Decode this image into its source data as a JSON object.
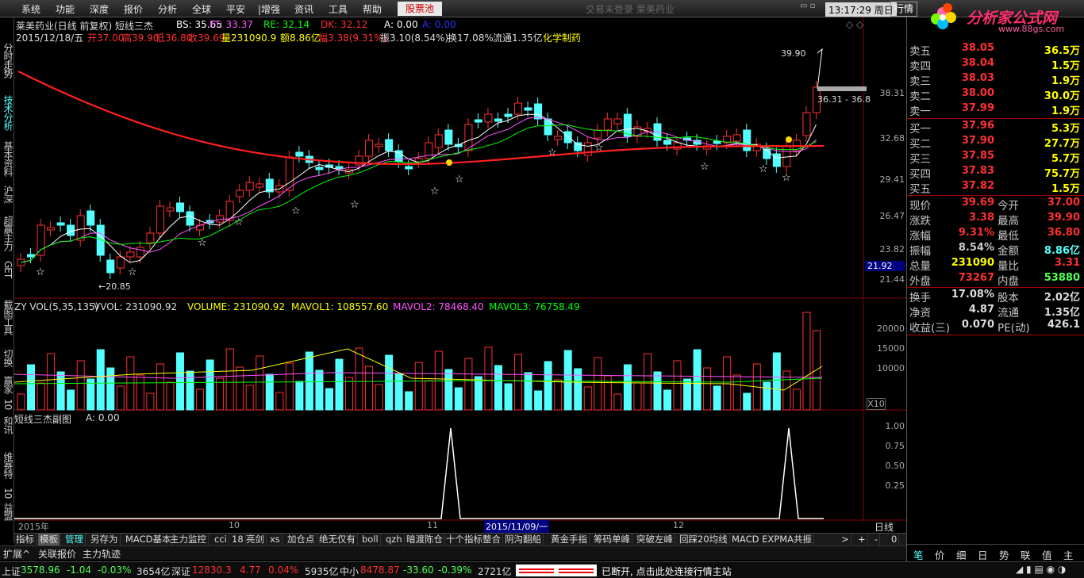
{
  "menu": [
    "系统",
    "功能",
    "深度",
    "报价",
    "分析",
    "全球",
    "平安",
    "|增强",
    "资讯",
    "工具",
    "帮助"
  ],
  "stock_pool": "股票池",
  "trade_status": "交易未登录    莱美药业",
  "datetime": "13:17:29 周日",
  "quote_button": "行情",
  "logo": {
    "text": "分析家公式网",
    "url": "www.88gs.com"
  },
  "left_tabs": [
    "分时走势",
    "技术分析",
    "基本资料",
    "沪深",
    "超赢主力",
    "GET",
    "截图工具",
    "切换",
    "赢家",
    "10",
    "和讯",
    "维赛特",
    "10",
    "益盟"
  ],
  "header": {
    "title_line": "莱美药业(日线 前复权) 短线三杰",
    "bs": "BS: 35.65",
    "ft": "FT: 33.37",
    "re": "RE: 32.14",
    "dk": "DK: 32.12",
    "a": "A: 0.00",
    "b": "A: 0.00",
    "date": "2015/12/18/五",
    "open": "开37.00",
    "high": "高39.90",
    "low": "低36.80",
    "close": "收39.69",
    "vol": "量231090.9",
    "amount": "额8.86亿",
    "range": "幅3.38(9.31%)",
    "amp": "振3.10(8.54%)",
    "turnover": "换17.08%",
    "float": "流通1.35亿",
    "sector": "化学制药"
  },
  "price_axis": [
    "38.31",
    "32.68",
    "29.41",
    "26.47",
    "23.82",
    "21.92",
    "21.44"
  ],
  "price_markers": {
    "high": "39.90",
    "low": "←20.85",
    "band": "36.31 - 36.8"
  },
  "vol_header": {
    "name": "ZY VOL(5,35,135)",
    "vvol": "VVOL: 231090.92",
    "volume": "VOLUME: 231090.92",
    "mavol1": "MAVOL1: 108557.60",
    "mavol2": "MAVOL2: 78468.40",
    "mavol3": "MAVOL3: 76758.49"
  },
  "vol_axis": [
    "20000",
    "15000",
    "10000",
    "X10"
  ],
  "sub_header": {
    "name": "短线三杰副图",
    "a": "A: 0.00"
  },
  "sub_axis": [
    "1.00",
    "0.75",
    "0.50",
    "0.25"
  ],
  "date_axis": [
    "2015年",
    "10",
    "11",
    "2015/11/09/一",
    "12",
    "日线"
  ],
  "indicator_tabs": [
    "指标",
    "模板",
    "管理",
    "另存为",
    "MACD基本",
    "主力监控",
    "cci",
    "18",
    "亮剑",
    "xs",
    "加仓点",
    "绝无仅有",
    "boll",
    "qzh",
    "暗渡陈仓",
    "十个指标整合",
    "阴沟翻船",
    "黄金手指",
    "筹码单峰",
    "突破左峰",
    "回踩20均线",
    "MACD EXPMA共振",
    ">",
    "+",
    "-",
    "0"
  ],
  "sub_tabs": [
    "扩展^",
    "关联报价",
    "主力轨迹"
  ],
  "quotes": {
    "sell": [
      {
        "label": "卖五",
        "price": "38.05",
        "vol": "36.5万"
      },
      {
        "label": "卖四",
        "price": "38.04",
        "vol": "1.5万"
      },
      {
        "label": "卖三",
        "price": "38.03",
        "vol": "1.9万"
      },
      {
        "label": "卖二",
        "price": "38.00",
        "vol": "30.0万"
      },
      {
        "label": "卖一",
        "price": "37.99",
        "vol": "1.9万"
      }
    ],
    "buy": [
      {
        "label": "买一",
        "price": "37.96",
        "vol": "5.3万"
      },
      {
        "label": "买二",
        "price": "37.90",
        "vol": "27.7万"
      },
      {
        "label": "买三",
        "price": "37.85",
        "vol": "5.7万"
      },
      {
        "label": "买四",
        "price": "37.83",
        "vol": "75.7万"
      },
      {
        "label": "买五",
        "price": "37.82",
        "vol": "1.5万"
      }
    ],
    "stats": [
      {
        "l1": "现价",
        "v1": "39.69",
        "l2": "今开",
        "v2": "37.00"
      },
      {
        "l1": "涨跌",
        "v1": "3.38",
        "l2": "最高",
        "v2": "39.90"
      },
      {
        "l1": "涨幅",
        "v1": "9.31%",
        "l2": "最低",
        "v2": "36.80"
      },
      {
        "l1": "振幅",
        "v1": "8.54%",
        "l2": "金额",
        "v2": "8.86亿"
      },
      {
        "l1": "总量",
        "v1": "231090",
        "l2": "量比",
        "v2": "3.31"
      },
      {
        "l1": "外盘",
        "v1": "73267",
        "l2": "内盘",
        "v2": "53880"
      }
    ],
    "stats2": [
      {
        "l1": "换手",
        "v1": "17.08%",
        "l2": "股本",
        "v2": "2.02亿"
      },
      {
        "l1": "净资",
        "v1": "4.87",
        "l2": "流通",
        "v2": "1.35亿"
      },
      {
        "l1": "收益(三)",
        "v1": "0.070",
        "l2": "PE(动)",
        "v2": "426.1"
      }
    ]
  },
  "right_tabs": [
    "笔",
    "价",
    "细",
    "日",
    "势",
    "联",
    "值",
    "主"
  ],
  "status": {
    "sh_label": "上证",
    "sh_val": "3578.96",
    "sh_chg": "-1.04",
    "sh_pct": "-0.03%",
    "sh_amt": "3654亿",
    "sz_label": "深证",
    "sz_val": "12830.3",
    "sz_chg": "4.77",
    "sz_pct": "0.04%",
    "sz_amt": "5935亿",
    "zx_label": "中小",
    "zx_val": "8478.87",
    "zx_chg": "-33.60",
    "zx_pct": "-0.39%",
    "zx_amt": "2721亿",
    "msg": "已断开, 点击此处连接行情主站"
  },
  "colors": {
    "up": "#ff3030",
    "down": "#54ffff",
    "ma": "#ffffff",
    "accent": "#ffff00"
  },
  "chart_data": {
    "type": "candlestick",
    "last_candle": {
      "open": 37.0,
      "high": 39.9,
      "low": 36.8,
      "close": 39.69,
      "volume": 231090.92
    },
    "price_low_marker": 20.85,
    "price_high_marker": 39.9,
    "volume_ma": {
      "MAVOL1": 108557.6,
      "MAVOL2": 78468.4,
      "MAVOL3": 76758.49
    },
    "signal_peaks": [
      "2015/11",
      "2015/12"
    ]
  }
}
